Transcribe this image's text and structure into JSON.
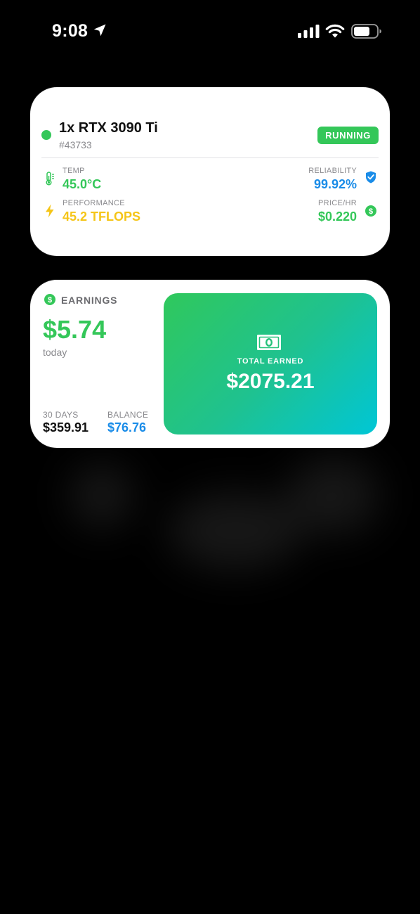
{
  "status_bar": {
    "time": "9:08"
  },
  "gpu": {
    "name": "1x RTX 3090 Ti",
    "id": "#43733",
    "status": "RUNNING",
    "temp": {
      "label": "TEMP",
      "value": "45.0°C"
    },
    "performance": {
      "label": "PERFORMANCE",
      "value": "45.2 TFLOPS"
    },
    "reliability": {
      "label": "RELIABILITY",
      "value": "99.92%"
    },
    "price": {
      "label": "PRICE/HR",
      "value": "$0.220"
    }
  },
  "earnings": {
    "header": "EARNINGS",
    "today_value": "$5.74",
    "today_label": "today",
    "days30": {
      "label": "30 DAYS",
      "value": "$359.91"
    },
    "balance": {
      "label": "BALANCE",
      "value": "$76.76"
    },
    "total": {
      "label": "TOTAL EARNED",
      "value": "$2075.21"
    }
  },
  "colors": {
    "green": "#34c759",
    "blue": "#1a8ce8",
    "yellow": "#f5c518",
    "gradient_start": "#30c85c",
    "gradient_end": "#00c6d6"
  },
  "icons": {
    "status": [
      "location-arrow-icon",
      "cellular-signal-icon",
      "wifi-icon",
      "battery-icon"
    ],
    "gpu": [
      "thermometer-icon",
      "lightning-bolt-icon",
      "shield-check-icon",
      "dollar-circle-icon"
    ],
    "earnings": [
      "dollar-circle-icon",
      "cash-icon"
    ]
  }
}
